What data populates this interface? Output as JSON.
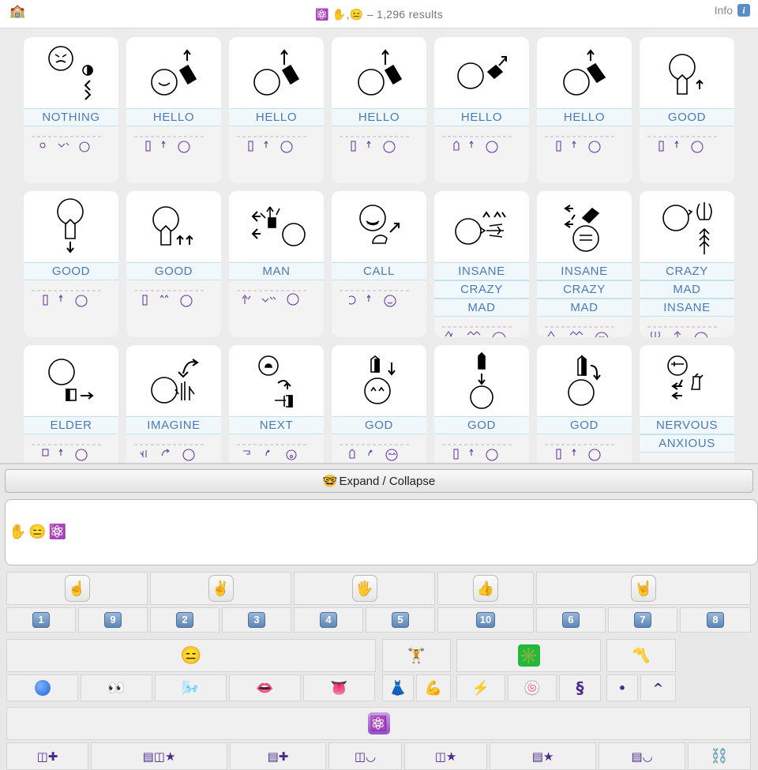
{
  "header": {
    "home_icon": "🏫",
    "title": "⚛️ ✋,😑 – 1,296 results",
    "info_label": "Info",
    "info_icon": "i"
  },
  "cards": [
    {
      "glosses": [
        "NOTHING"
      ]
    },
    {
      "glosses": [
        "HELLO"
      ]
    },
    {
      "glosses": [
        "HELLO"
      ]
    },
    {
      "glosses": [
        "HELLO"
      ]
    },
    {
      "glosses": [
        "HELLO"
      ]
    },
    {
      "glosses": [
        "HELLO"
      ]
    },
    {
      "glosses": [
        "GOOD"
      ]
    },
    {
      "glosses": [
        "GOOD"
      ]
    },
    {
      "glosses": [
        "GOOD"
      ]
    },
    {
      "glosses": [
        "MAN"
      ]
    },
    {
      "glosses": [
        "CALL"
      ]
    },
    {
      "glosses": [
        "INSANE",
        "CRAZY",
        "MAD"
      ]
    },
    {
      "glosses": [
        "INSANE",
        "CRAZY",
        "MAD"
      ]
    },
    {
      "glosses": [
        "CRAZY",
        "MAD",
        "INSANE"
      ]
    },
    {
      "glosses": [
        "ELDER"
      ]
    },
    {
      "glosses": [
        "IMAGINE"
      ]
    },
    {
      "glosses": [
        "NEXT"
      ]
    },
    {
      "glosses": [
        "GOD"
      ]
    },
    {
      "glosses": [
        "GOD"
      ]
    },
    {
      "glosses": [
        "GOD"
      ]
    },
    {
      "glosses": [
        "NERVOUS",
        "ANXIOUS"
      ]
    }
  ],
  "expand": {
    "icon": "🤓",
    "label": "Expand / Collapse"
  },
  "editor_tokens": [
    "✋",
    "😑",
    "⚛️"
  ],
  "keyboard": {
    "handshapes": [
      "☝️",
      "✌️",
      "🖐️",
      "👍",
      "🤘"
    ],
    "numbers": [
      "1",
      "9",
      "2",
      "3",
      "4",
      "5",
      "10",
      "6",
      "7",
      "8"
    ],
    "face_key": "😑",
    "movement_key": "🏋️",
    "dynamics_key": "✳️",
    "punct_key": "〽️",
    "row2": [
      "🔵",
      "👀",
      "🌬️",
      "👄",
      "👅",
      "👗",
      "💪",
      "⚡",
      "🍥",
      "§",
      "•",
      "^"
    ],
    "atom_key": "⚛️",
    "sequence": [
      "◫✚",
      "▤◫★",
      "▤✚",
      "◫◡",
      "◫★",
      "▤★",
      "▤◡"
    ],
    "last_key": "⛓️"
  }
}
